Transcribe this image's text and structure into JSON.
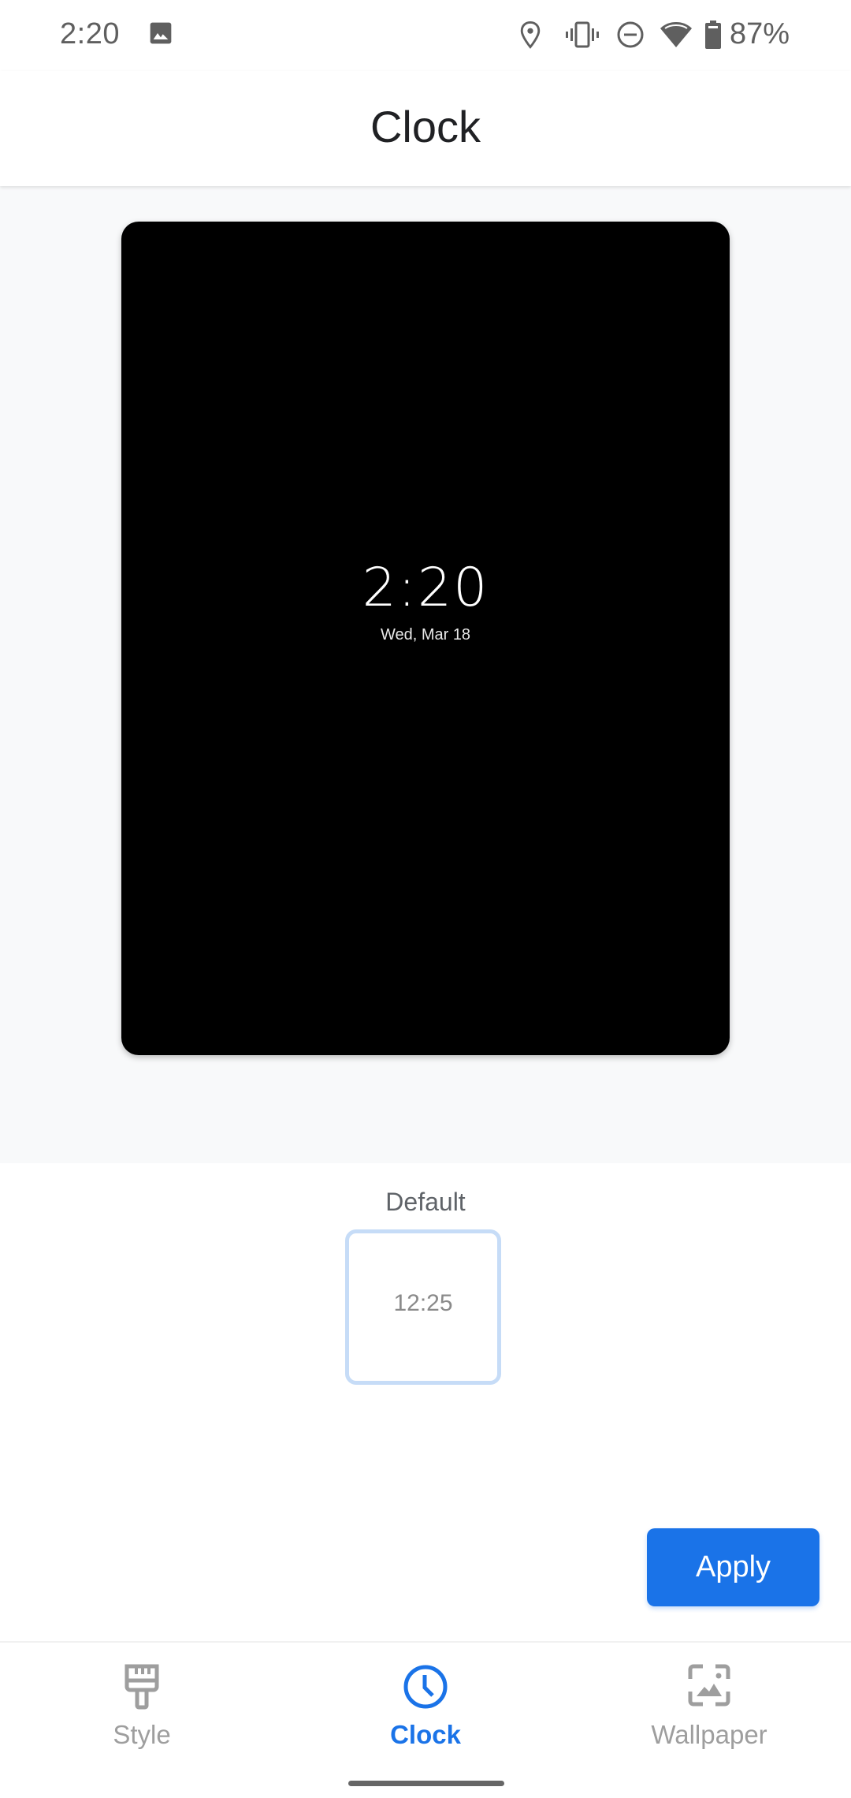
{
  "status_bar": {
    "time": "2:20",
    "notification_icons": [
      "image-icon"
    ],
    "system_icons": [
      "location-icon",
      "vibrate-icon",
      "do-not-disturb-icon",
      "wifi-icon",
      "battery-icon"
    ],
    "battery_percent": "87%"
  },
  "header": {
    "title": "Clock"
  },
  "preview": {
    "time": "2:20",
    "date": "Wed, Mar 18"
  },
  "options": {
    "selected_label": "Default",
    "items": [
      {
        "label": "Default",
        "thumb_time": "12:25",
        "selected": true
      }
    ]
  },
  "actions": {
    "apply_label": "Apply"
  },
  "bottom_nav": {
    "items": [
      {
        "label": "Style",
        "icon": "paintbrush-icon",
        "active": false
      },
      {
        "label": "Clock",
        "icon": "clock-icon",
        "active": true
      },
      {
        "label": "Wallpaper",
        "icon": "wallpaper-icon",
        "active": false
      }
    ]
  },
  "colors": {
    "accent": "#1a73e8",
    "inactive": "#9e9e9e",
    "selected_border": "#c6dcf7",
    "preview_bg": "#f8f9fa"
  }
}
